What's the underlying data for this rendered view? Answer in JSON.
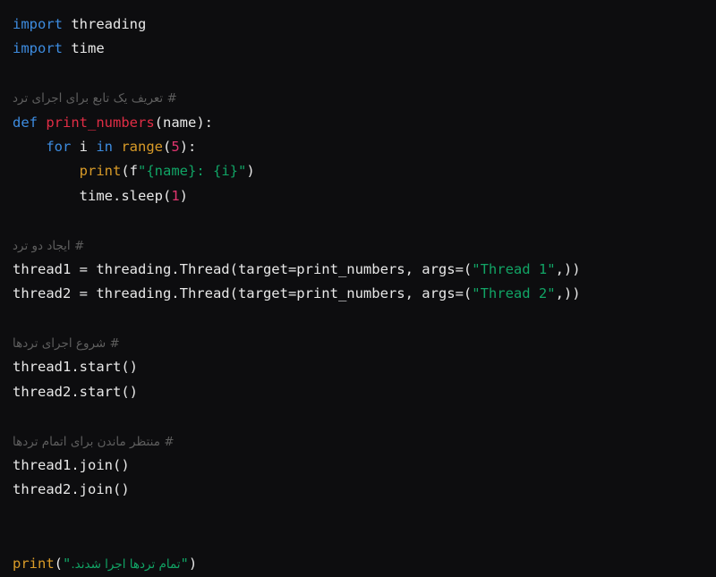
{
  "editor": {
    "language": "Python",
    "background_color": "#0d0d0f",
    "default_text_color": "#e8e8e8",
    "theme_colors": {
      "keyword": "#3d8ce0",
      "function_name": "#e02d45",
      "builtin": "#d99b28",
      "number": "#e0356f",
      "string": "#11a465",
      "comment": "#5e5e5e",
      "punctuation": "#e8e8e8"
    }
  },
  "code": {
    "line1": {
      "kw": "import",
      "mod": " threading"
    },
    "line2": {
      "kw": "import",
      "mod": " time"
    },
    "line4_comment": "# تعریف یک تابع برای اجرای ترد",
    "line5": {
      "kw": "def",
      "name": " print_numbers",
      "open": "(",
      "param": "name",
      "close": "):"
    },
    "line6": {
      "indent": "    ",
      "kw_for": "for",
      "var": " i ",
      "kw_in": "in",
      "fn": " range",
      "open": "(",
      "num": "5",
      "close": "):"
    },
    "line7": {
      "indent": "        ",
      "fn": "print",
      "open": "(",
      "fprefix": "f",
      "str": "\"{name}: {i}\"",
      "close": ")"
    },
    "line8": {
      "indent": "        ",
      "expr": "time.sleep",
      "open": "(",
      "num": "1",
      "close": ")"
    },
    "line10_comment": "# ایجاد دو ترد",
    "line11": {
      "pre": "thread1 = threading.Thread(target=print_numbers, args=(",
      "str": "\"Thread 1\"",
      "post": ",))"
    },
    "line12": {
      "pre": "thread2 = threading.Thread(target=print_numbers, args=(",
      "str": "\"Thread 2\"",
      "post": ",))"
    },
    "line14_comment": "# شروع اجرای تردها",
    "line15": "thread1.start()",
    "line16": "thread2.start()",
    "line18_comment": "# منتظر ماندن برای اتمام تردها",
    "line19": "thread1.join()",
    "line20": "thread2.join()",
    "line22": {
      "fn": "print",
      "open": "(",
      "quote_open": "\"",
      "str": "تمام تردها اجرا شدند.",
      "quote_close": "\"",
      "close": ")"
    }
  }
}
